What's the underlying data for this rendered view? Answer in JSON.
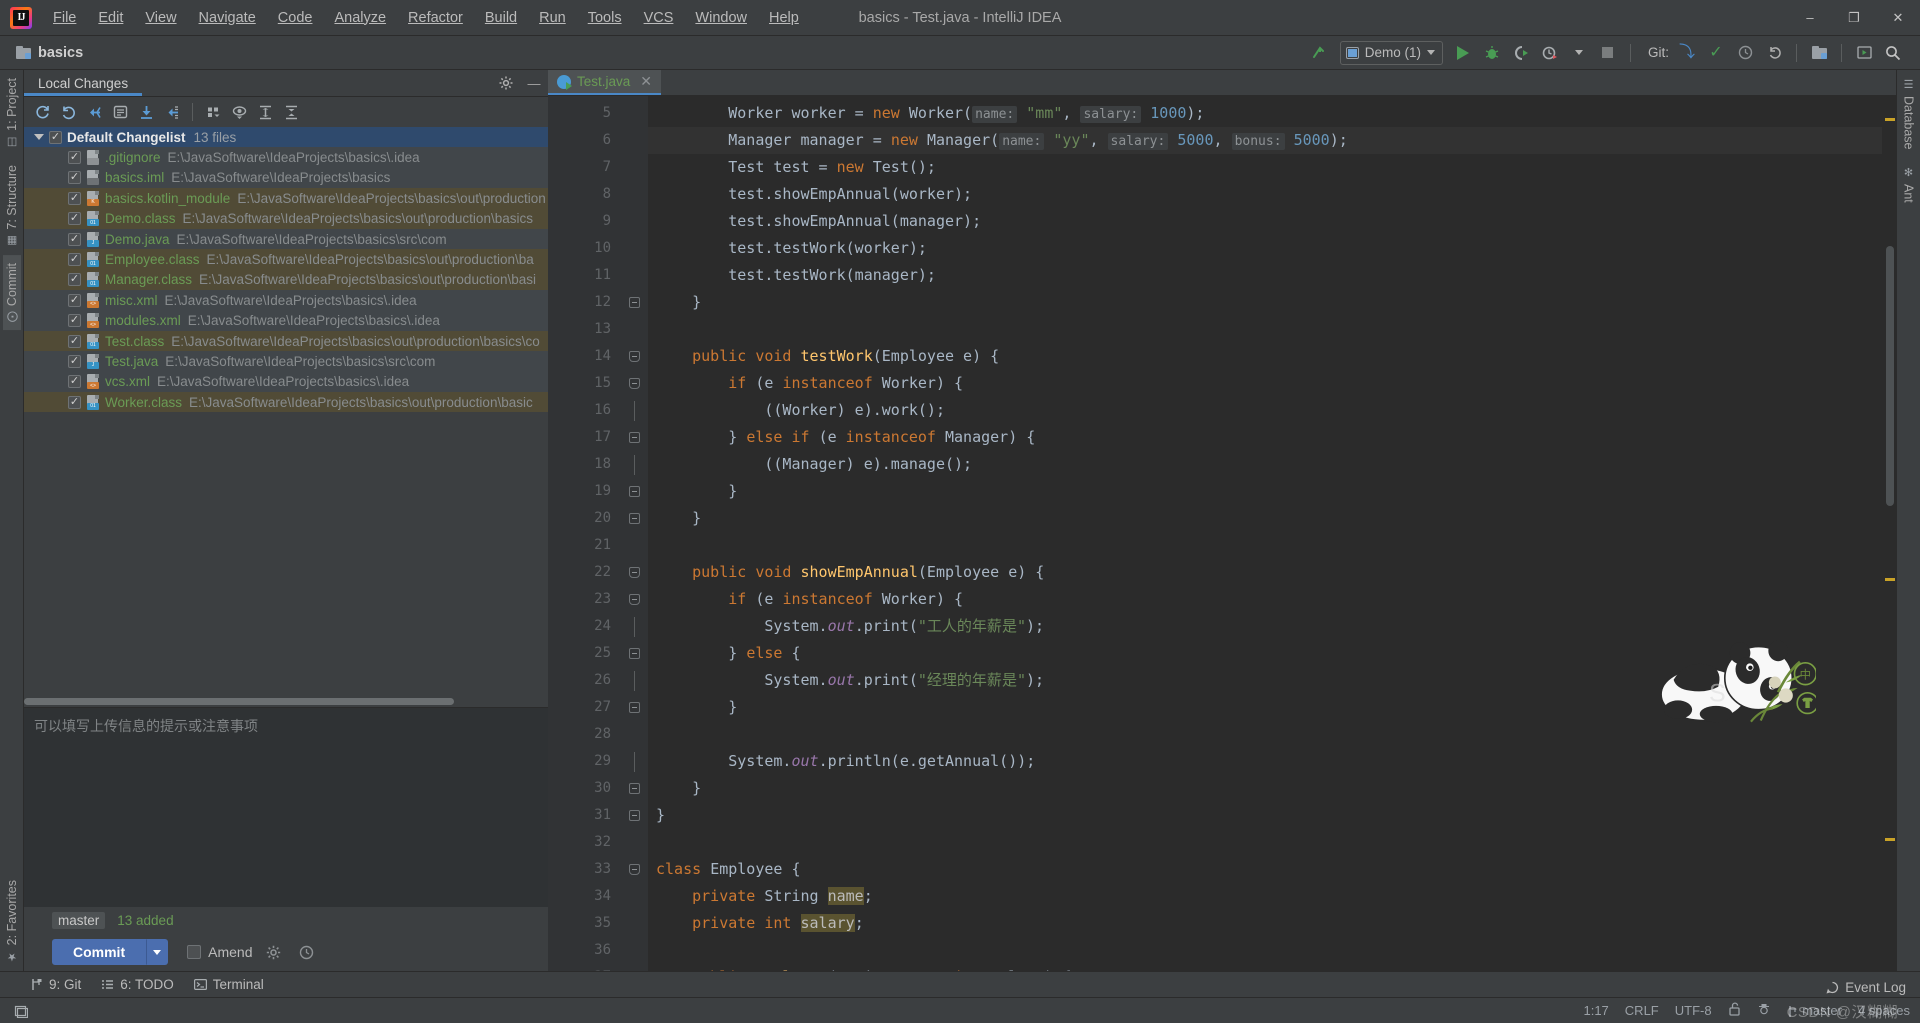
{
  "window": {
    "title": "basics - Test.java - IntelliJ IDEA",
    "minimize": "–",
    "maximize": "❐",
    "close": "✕"
  },
  "menu": [
    {
      "label": "File"
    },
    {
      "label": "Edit"
    },
    {
      "label": "View"
    },
    {
      "label": "Navigate"
    },
    {
      "label": "Code"
    },
    {
      "label": "Analyze"
    },
    {
      "label": "Refactor"
    },
    {
      "label": "Build"
    },
    {
      "label": "Run"
    },
    {
      "label": "Tools"
    },
    {
      "label": "VCS"
    },
    {
      "label": "Window"
    },
    {
      "label": "Help"
    }
  ],
  "navbar": {
    "breadcrumb": "basics",
    "run_config": "Demo (1)",
    "git_label": "Git:"
  },
  "left_strip": [
    {
      "label": "1: Project",
      "icon": "project-icon"
    },
    {
      "label": "7: Structure",
      "icon": "structure-icon"
    },
    {
      "label": "Commit",
      "icon": "commit-icon"
    }
  ],
  "left_strip_bottom": [
    {
      "label": "2: Favorites",
      "icon": "star-icon"
    }
  ],
  "right_strip": [
    {
      "label": "Database",
      "icon": "database-icon"
    },
    {
      "label": "Ant",
      "icon": "ant-icon"
    }
  ],
  "commit_panel": {
    "tab": "Local Changes",
    "changelist": {
      "title": "Default Changelist",
      "count": "13 files"
    },
    "files": [
      {
        "name": ".gitignore",
        "path": "E:\\JavaSoftware\\IdeaProjects\\basics\\.idea",
        "kind": "git",
        "row": "norm"
      },
      {
        "name": "basics.iml",
        "path": "E:\\JavaSoftware\\IdeaProjects\\basics",
        "kind": "iml",
        "row": "norm"
      },
      {
        "name": "basics.kotlin_module",
        "path": "E:\\JavaSoftware\\IdeaProjects\\basics\\out\\production",
        "kind": "kt",
        "row": "alt"
      },
      {
        "name": "Demo.class",
        "path": "E:\\JavaSoftware\\IdeaProjects\\basics\\out\\production\\basics",
        "kind": "cls",
        "row": "alt"
      },
      {
        "name": "Demo.java",
        "path": "E:\\JavaSoftware\\IdeaProjects\\basics\\src\\com",
        "kind": "java",
        "row": "norm"
      },
      {
        "name": "Employee.class",
        "path": "E:\\JavaSoftware\\IdeaProjects\\basics\\out\\production\\ba",
        "kind": "cls",
        "row": "alt"
      },
      {
        "name": "Manager.class",
        "path": "E:\\JavaSoftware\\IdeaProjects\\basics\\out\\production\\basi",
        "kind": "cls",
        "row": "alt"
      },
      {
        "name": "misc.xml",
        "path": "E:\\JavaSoftware\\IdeaProjects\\basics\\.idea",
        "kind": "xml",
        "row": "norm"
      },
      {
        "name": "modules.xml",
        "path": "E:\\JavaSoftware\\IdeaProjects\\basics\\.idea",
        "kind": "xml",
        "row": "norm"
      },
      {
        "name": "Test.class",
        "path": "E:\\JavaSoftware\\IdeaProjects\\basics\\out\\production\\basics\\co",
        "kind": "cls",
        "row": "alt"
      },
      {
        "name": "Test.java",
        "path": "E:\\JavaSoftware\\IdeaProjects\\basics\\src\\com",
        "kind": "java",
        "row": "norm"
      },
      {
        "name": "vcs.xml",
        "path": "E:\\JavaSoftware\\IdeaProjects\\basics\\.idea",
        "kind": "xml",
        "row": "norm"
      },
      {
        "name": "Worker.class",
        "path": "E:\\JavaSoftware\\IdeaProjects\\basics\\out\\production\\basic",
        "kind": "cls",
        "row": "alt"
      }
    ],
    "message_placeholder": "可以填写上传信息的提示或注意事项",
    "branch": "master",
    "added": "13 added",
    "commit_button": "Commit",
    "amend_label": "Amend"
  },
  "editor": {
    "tab": "Test.java",
    "tab_close": "✕",
    "first_line": 5,
    "lines": [
      {
        "n": 5,
        "fold": "",
        "current": false,
        "html": "        <span class='plain'>Worker worker = </span><span class='kw'>new </span><span class='plain'>Worker(</span><span class='hint'>name:</span><span class='plain'> </span><span class='str'>\"mm\"</span><span class='plain'>, </span><span class='hint'>salary:</span><span class='plain'> </span><span class='num'>1000</span><span class='plain'>);</span>"
      },
      {
        "n": 6,
        "fold": "",
        "current": true,
        "html": "        <span class='plain'>Manager manager = </span><span class='kw'>new </span><span class='plain'>Manager(</span><span class='hint'>name:</span><span class='plain'> </span><span class='str'>\"yy\"</span><span class='plain'>, </span><span class='hint'>salary:</span><span class='plain'> </span><span class='num'>5000</span><span class='plain'>, </span><span class='hint'>bonus:</span><span class='plain'> </span><span class='num'>5000</span><span class='plain'>);</span>"
      },
      {
        "n": 7,
        "fold": "",
        "current": false,
        "html": "        <span class='plain'>Test test = </span><span class='kw'>new </span><span class='plain'>Test();</span>"
      },
      {
        "n": 8,
        "fold": "",
        "current": false,
        "html": "        <span class='plain'>test.showEmpAnnual(worker);</span>"
      },
      {
        "n": 9,
        "fold": "",
        "current": false,
        "html": "        <span class='plain'>test.showEmpAnnual(manager);</span>"
      },
      {
        "n": 10,
        "fold": "",
        "current": false,
        "html": "        <span class='plain'>test.testWork(worker);</span>"
      },
      {
        "n": 11,
        "fold": "",
        "current": false,
        "html": "        <span class='plain'>test.testWork(manager);</span>"
      },
      {
        "n": 12,
        "fold": "end",
        "current": false,
        "html": "    <span class='plain'>}</span>"
      },
      {
        "n": 13,
        "fold": "",
        "current": false,
        "html": ""
      },
      {
        "n": 14,
        "fold": "open",
        "current": false,
        "html": "    <span class='kw'>public void </span><span class='fn'>testWork</span><span class='plain'>(Employee e) {</span>"
      },
      {
        "n": 15,
        "fold": "open",
        "current": false,
        "html": "        <span class='kw'>if </span><span class='plain'>(e </span><span class='kw'>instanceof </span><span class='plain'>Worker) {</span>"
      },
      {
        "n": 16,
        "fold": "bar",
        "current": false,
        "html": "            <span class='plain'>((Worker) e).work();</span>"
      },
      {
        "n": 17,
        "fold": "end",
        "current": false,
        "html": "        <span class='plain'>} </span><span class='kw'>else if </span><span class='plain'>(e </span><span class='kw'>instanceof </span><span class='plain'>Manager) {</span>"
      },
      {
        "n": 18,
        "fold": "bar",
        "current": false,
        "html": "            <span class='plain'>((Manager) e).manage();</span>"
      },
      {
        "n": 19,
        "fold": "end",
        "current": false,
        "html": "        <span class='plain'>}</span>"
      },
      {
        "n": 20,
        "fold": "end",
        "current": false,
        "html": "    <span class='plain'>}</span>"
      },
      {
        "n": 21,
        "fold": "",
        "current": false,
        "html": ""
      },
      {
        "n": 22,
        "fold": "open",
        "current": false,
        "html": "    <span class='kw'>public void </span><span class='fn'>showEmpAnnual</span><span class='plain'>(Employee e) {</span>"
      },
      {
        "n": 23,
        "fold": "open",
        "current": false,
        "html": "        <span class='kw'>if </span><span class='plain'>(e </span><span class='kw'>instanceof </span><span class='plain'>Worker) {</span>"
      },
      {
        "n": 24,
        "fold": "bar",
        "current": false,
        "html": "            <span class='plain'>System.</span><span class='fld'>out</span><span class='plain'>.print(</span><span class='str'>\"工人的年薪是\"</span><span class='plain'>);</span>"
      },
      {
        "n": 25,
        "fold": "end",
        "current": false,
        "html": "        <span class='plain'>} </span><span class='kw'>else </span><span class='plain'>{</span>"
      },
      {
        "n": 26,
        "fold": "bar",
        "current": false,
        "html": "            <span class='plain'>System.</span><span class='fld'>out</span><span class='plain'>.print(</span><span class='str'>\"经理的年薪是\"</span><span class='plain'>);</span>"
      },
      {
        "n": 27,
        "fold": "end",
        "current": false,
        "html": "        <span class='plain'>}</span>"
      },
      {
        "n": 28,
        "fold": "",
        "current": false,
        "html": ""
      },
      {
        "n": 29,
        "fold": "bar",
        "current": false,
        "html": "        <span class='plain'>System.</span><span class='fld'>out</span><span class='plain'>.println(e.getAnnual());</span>"
      },
      {
        "n": 30,
        "fold": "end",
        "current": false,
        "html": "    <span class='plain'>}</span>"
      },
      {
        "n": 31,
        "fold": "endtop",
        "current": false,
        "html": "<span class='plain'>}</span>"
      },
      {
        "n": 32,
        "fold": "",
        "current": false,
        "html": ""
      },
      {
        "n": 33,
        "fold": "openc",
        "current": false,
        "html": "<span class='kw'>class </span><span class='plain'>Employee {</span>"
      },
      {
        "n": 34,
        "fold": "",
        "current": false,
        "html": "    <span class='kw'>private </span><span class='plain'>String </span><span class='hl'>name</span><span class='plain'>;</span>"
      },
      {
        "n": 35,
        "fold": "",
        "current": false,
        "html": "    <span class='kw'>private int </span><span class='hl'>salary</span><span class='plain'>;</span>"
      },
      {
        "n": 36,
        "fold": "",
        "current": false,
        "html": ""
      },
      {
        "n": 37,
        "fold": "open",
        "current": false,
        "html": "    <span class='kw'>public </span><span class='fn'>Employee</span><span class='plain'>(String name, </span><span class='kw'>int </span><span class='plain'>salary) {</span>"
      }
    ]
  },
  "bottom_tabs": [
    {
      "label": "9: Git",
      "icon": "git-branch-icon"
    },
    {
      "label": "6: TODO",
      "icon": "todo-list-icon"
    },
    {
      "label": "Terminal",
      "icon": "terminal-icon"
    }
  ],
  "status": {
    "event_log": "Event Log",
    "caret": "1:17",
    "line_sep": "CRLF",
    "encoding": "UTF-8",
    "branch": "master",
    "indent": "4 spaces",
    "watermark": "CSDN @汉糊糊"
  },
  "colors": {
    "accent_blue": "#4b6eaf",
    "tab_underline": "#4a88c7",
    "green_run": "#499c54",
    "file_green": "#6a9b55",
    "keyword_orange": "#cc7832",
    "string_green": "#6a8759",
    "number_blue": "#6897bb",
    "method_yellow": "#ffc66d",
    "bg_editor": "#2b2b2b",
    "bg_chrome": "#3c3f41"
  }
}
